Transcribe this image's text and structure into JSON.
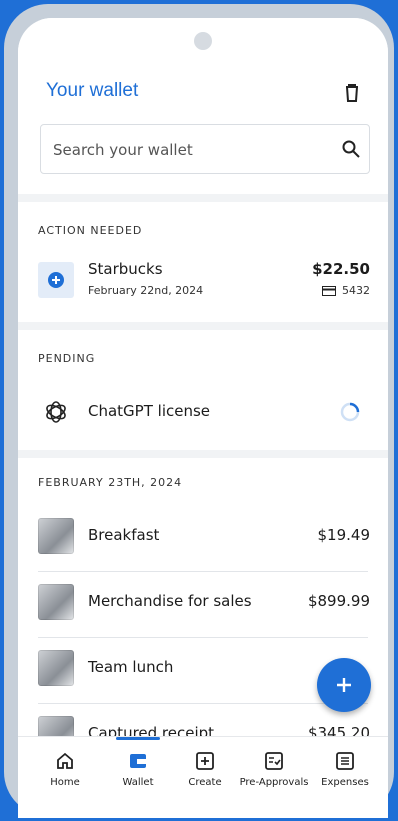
{
  "header": {
    "title": "Your wallet"
  },
  "search": {
    "placeholder": "Search your wallet"
  },
  "action_needed": {
    "label": "ACTION NEEDED",
    "item": {
      "title": "Starbucks",
      "date": "February 22nd, 2024",
      "amount": "$22.50",
      "card": "5432"
    }
  },
  "pending": {
    "label": "PENDING",
    "item": {
      "title": "ChatGPT license"
    }
  },
  "day_group": {
    "label": "FEBRUARY 23TH, 2024",
    "items": [
      {
        "title": "Breakfast",
        "amount": "$19.49"
      },
      {
        "title": "Merchandise for sales",
        "amount": "$899.99"
      },
      {
        "title": "Team lunch",
        "amount": ""
      },
      {
        "title": "Captured receipt",
        "amount": "$345.20"
      }
    ]
  },
  "fab": {
    "label": "+"
  },
  "nav": {
    "items": [
      {
        "label": "Home",
        "icon": "home-icon"
      },
      {
        "label": "Wallet",
        "icon": "wallet-icon"
      },
      {
        "label": "Create",
        "icon": "create-icon"
      },
      {
        "label": "Pre-Approvals",
        "icon": "pre-approvals-icon"
      },
      {
        "label": "Expenses",
        "icon": "expenses-icon"
      }
    ],
    "active": "Wallet"
  },
  "colors": {
    "accent": "#1f6fd6",
    "background": "#f1f3f5"
  }
}
